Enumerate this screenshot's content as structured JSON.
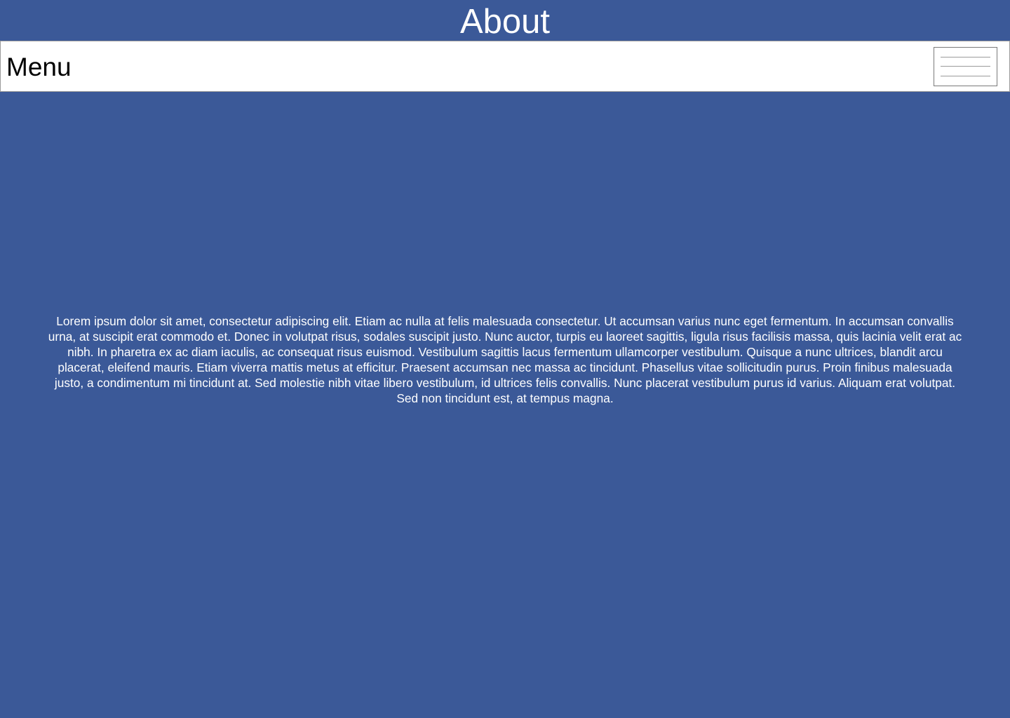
{
  "header": {
    "title": "About"
  },
  "menu_bar": {
    "label": "Menu",
    "toggle_icon": "hamburger-icon"
  },
  "main": {
    "paragraph": "Lorem ipsum dolor sit amet, consectetur adipiscing elit. Etiam ac nulla at felis malesuada consectetur. Ut accumsan varius nunc eget fermentum. In accumsan convallis urna, at suscipit erat commodo et. Donec in volutpat risus, sodales suscipit justo. Nunc auctor, turpis eu laoreet sagittis, ligula risus facilisis massa, quis lacinia velit erat ac nibh. In pharetra ex ac diam iaculis, ac consequat risus euismod. Vestibulum sagittis lacus fermentum ullamcorper vestibulum. Quisque a nunc ultrices, blandit arcu placerat, eleifend mauris. Etiam viverra mattis metus at efficitur. Praesent accumsan nec massa ac tincidunt. Phasellus vitae sollicitudin purus. Proin finibus malesuada justo, a condimentum mi tincidunt at. Sed molestie nibh vitae libero vestibulum, id ultrices felis convallis. Nunc placerat vestibulum purus id varius. Aliquam erat volutpat. Sed non tincidunt est, at tempus magna."
  },
  "colors": {
    "page_background": "#3b5998",
    "menu_bar_background": "#ffffff",
    "title_text": "#ffffff",
    "body_text": "#ffffff"
  }
}
